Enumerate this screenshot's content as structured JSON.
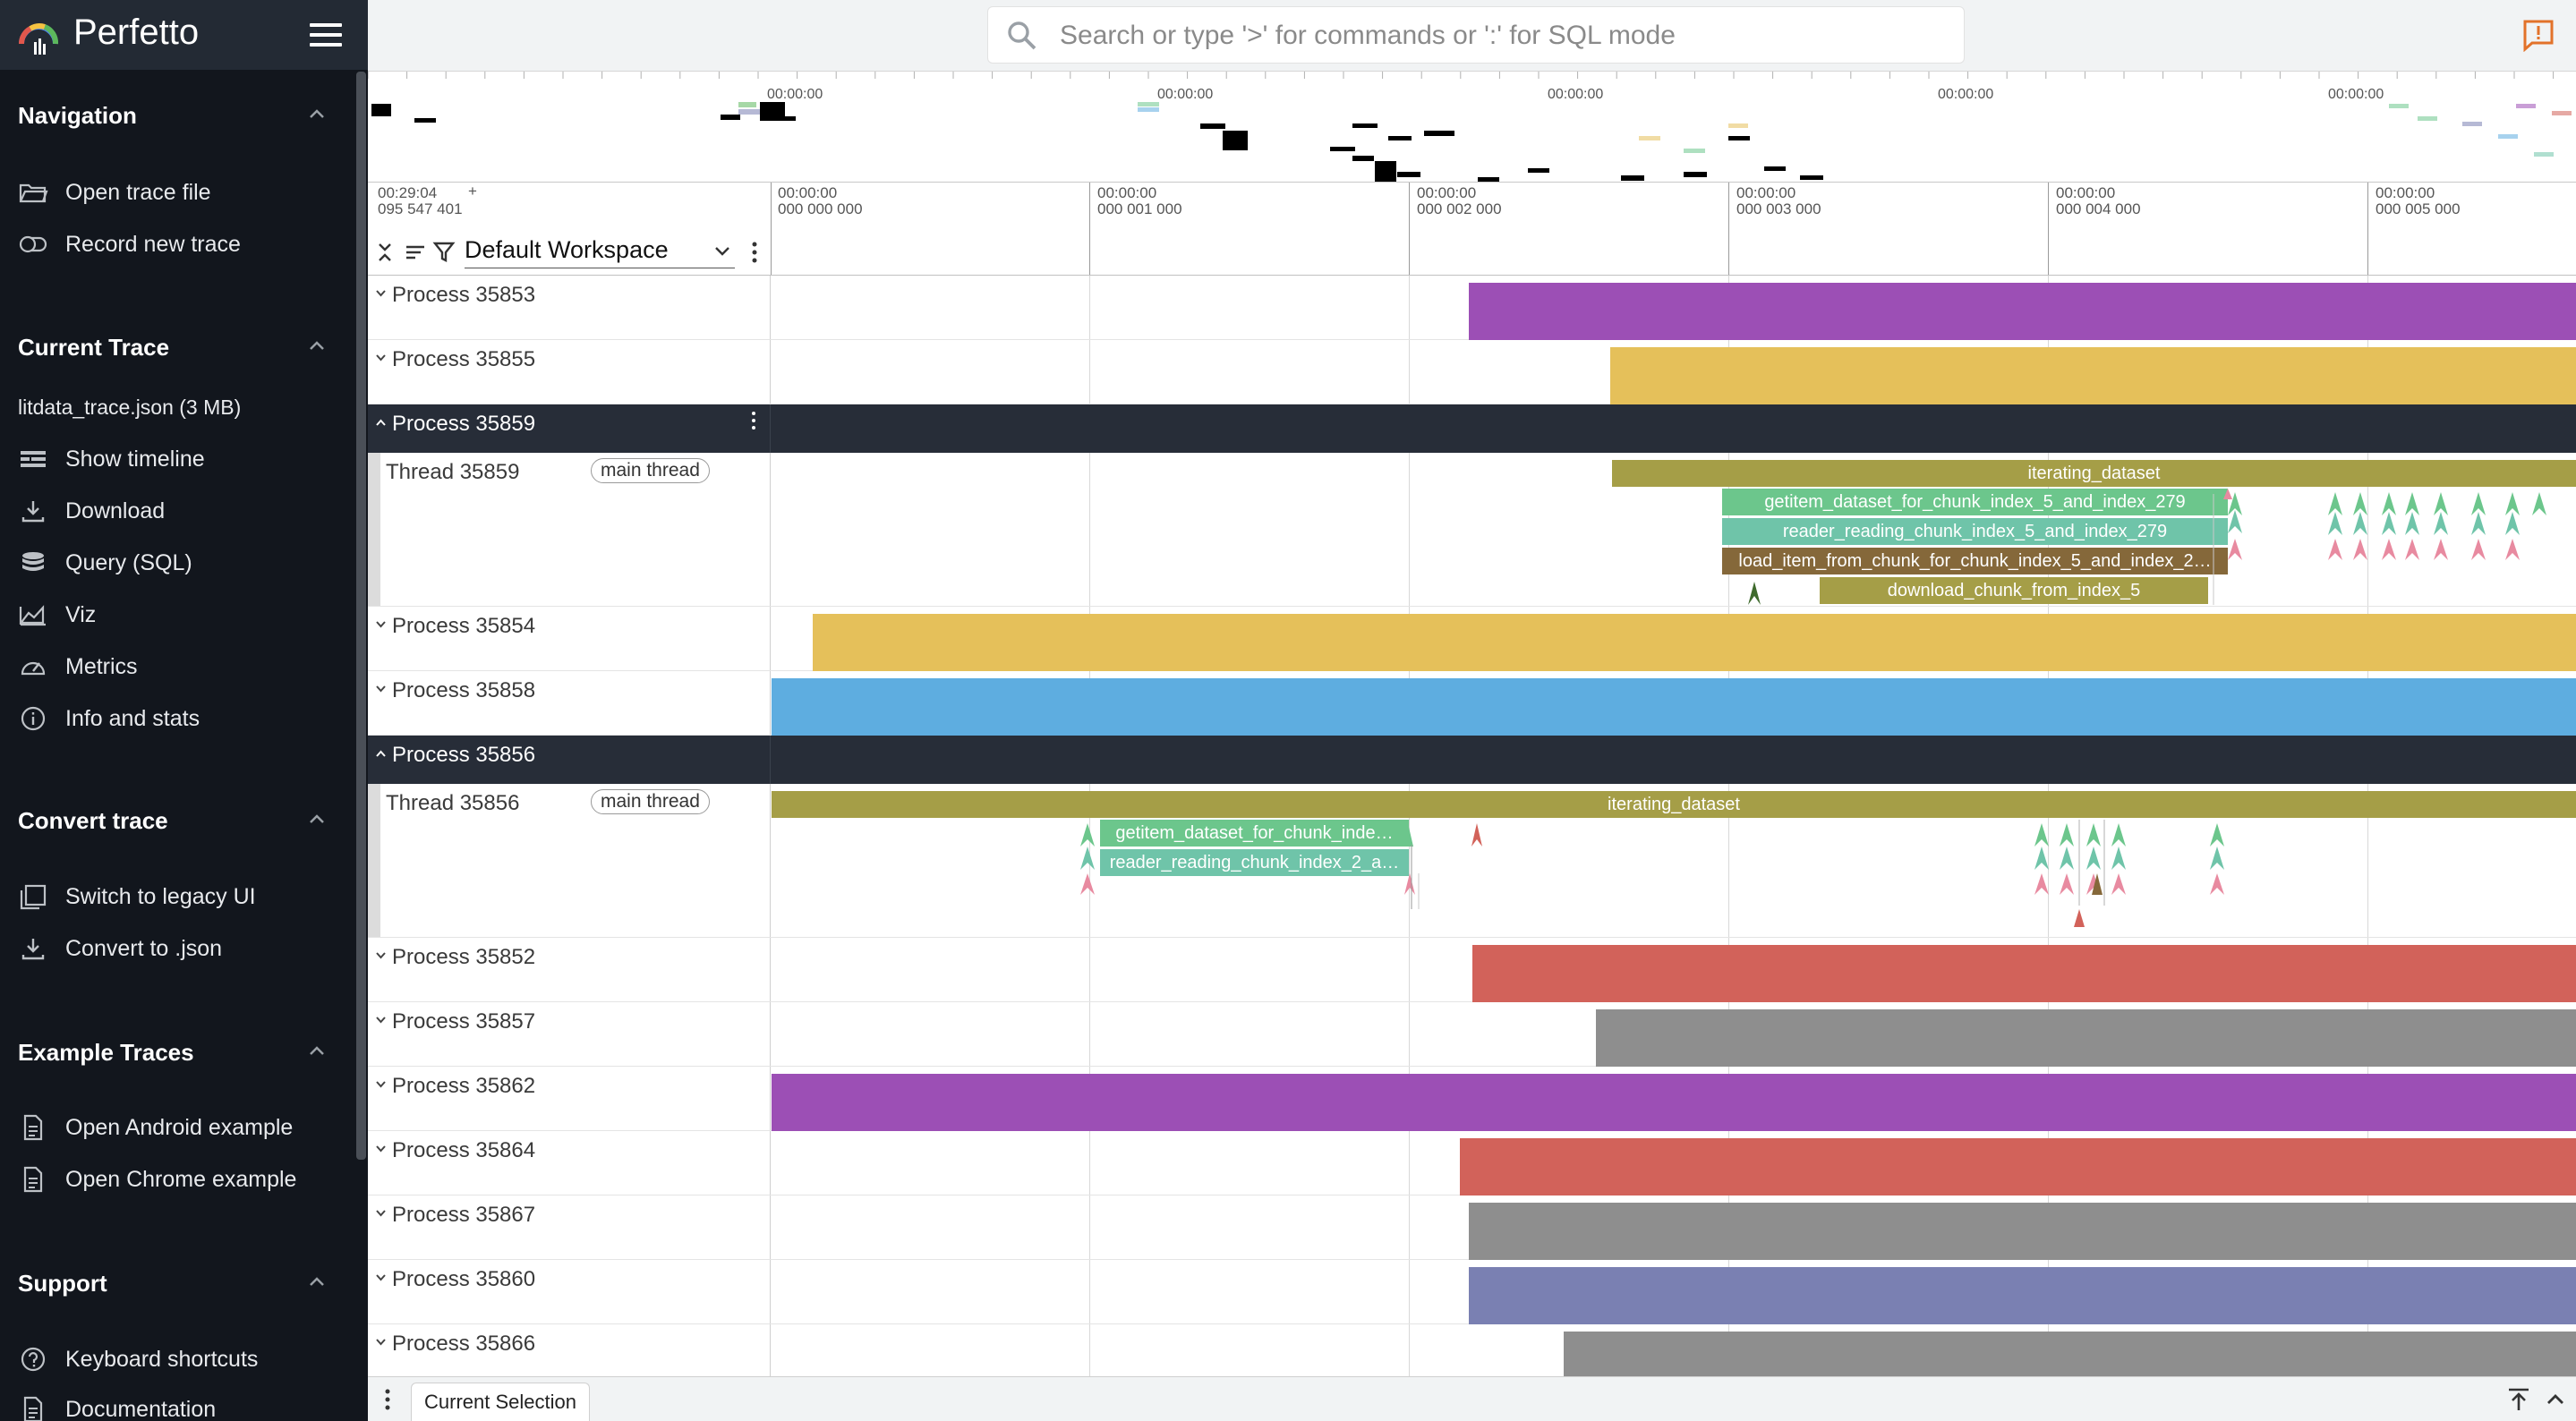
{
  "app": {
    "name": "Perfetto"
  },
  "sidebar": {
    "sections": [
      {
        "title": "Navigation",
        "items": [
          {
            "label": "Open trace file",
            "icon": "folder-open-icon"
          },
          {
            "label": "Record new trace",
            "icon": "record-icon"
          }
        ]
      },
      {
        "title": "Current Trace",
        "file": "litdata_trace.json (3 MB)",
        "items": [
          {
            "label": "Show timeline",
            "icon": "timeline-icon"
          },
          {
            "label": "Download",
            "icon": "download-icon"
          },
          {
            "label": "Query (SQL)",
            "icon": "database-icon"
          },
          {
            "label": "Viz",
            "icon": "chart-icon"
          },
          {
            "label": "Metrics",
            "icon": "speedometer-icon"
          },
          {
            "label": "Info and stats",
            "icon": "info-icon"
          }
        ]
      },
      {
        "title": "Convert trace",
        "items": [
          {
            "label": "Switch to legacy UI",
            "icon": "filter-none-icon"
          },
          {
            "label": "Convert to .json",
            "icon": "download-icon"
          }
        ]
      },
      {
        "title": "Example Traces",
        "items": [
          {
            "label": "Open Android example",
            "icon": "document-icon"
          },
          {
            "label": "Open Chrome example",
            "icon": "document-icon"
          }
        ]
      },
      {
        "title": "Support",
        "items": [
          {
            "label": "Keyboard shortcuts",
            "icon": "help-icon"
          },
          {
            "label": "Documentation",
            "icon": "document-icon"
          }
        ]
      }
    ]
  },
  "search": {
    "placeholder": "Search or type '>' for commands or ':' for SQL mode"
  },
  "overview": {
    "tick_labels": [
      "00:00:00",
      "00:00:00",
      "00:00:00",
      "00:00:00",
      "00:00:00"
    ]
  },
  "timeline": {
    "start_time": "00:29:04",
    "start_sub": "095 547 401",
    "plus": "+",
    "ticks": [
      {
        "t1": "00:00:00",
        "t2": "000 000 000"
      },
      {
        "t1": "00:00:00",
        "t2": "000 001 000"
      },
      {
        "t1": "00:00:00",
        "t2": "000 002 000"
      },
      {
        "t1": "00:00:00",
        "t2": "000 003 000"
      },
      {
        "t1": "00:00:00",
        "t2": "000 004 000"
      },
      {
        "t1": "00:00:00",
        "t2": "000 005 000"
      }
    ]
  },
  "workspace": {
    "name": "Default Workspace"
  },
  "tracks": [
    {
      "type": "process",
      "name": "Process 35853",
      "color": "#9c4fb5"
    },
    {
      "type": "process",
      "name": "Process 35855",
      "color": "#e5c05a"
    },
    {
      "type": "process-header",
      "name": "Process 35859"
    },
    {
      "type": "thread",
      "name": "Thread 35859",
      "tag": "main thread",
      "slices": [
        {
          "label": "iterating_dataset",
          "color": "#a59e47"
        },
        {
          "label": "getitem_dataset_for_chunk_index_5_and_index_279",
          "color": "#6cc68c"
        },
        {
          "label": "reader_reading_chunk_index_5_and_index_279",
          "color": "#6fc4a9"
        },
        {
          "label": "load_item_from_chunk_for_chunk_index_5_and_index_2…",
          "color": "#85683a"
        },
        {
          "label": "download_chunk_from_index_5",
          "color": "#a59e47"
        }
      ]
    },
    {
      "type": "process",
      "name": "Process 35854",
      "color": "#e5c05a"
    },
    {
      "type": "process",
      "name": "Process 35858",
      "color": "#5eade0"
    },
    {
      "type": "process-header",
      "name": "Process 35856"
    },
    {
      "type": "thread",
      "name": "Thread 35856",
      "tag": "main thread",
      "slices": [
        {
          "label": "iterating_dataset",
          "color": "#a59e47"
        },
        {
          "label": "getitem_dataset_for_chunk_inde…",
          "color": "#6cc68c"
        },
        {
          "label": "reader_reading_chunk_index_2_a…",
          "color": "#6fc4a9"
        }
      ]
    },
    {
      "type": "process",
      "name": "Process 35852",
      "color": "#d2625a"
    },
    {
      "type": "process",
      "name": "Process 35857",
      "color": "#8e8e8e"
    },
    {
      "type": "process",
      "name": "Process 35862",
      "color": "#9c4fb5"
    },
    {
      "type": "process",
      "name": "Process 35864",
      "color": "#d2625a"
    },
    {
      "type": "process",
      "name": "Process 35867",
      "color": "#8e8e8e"
    },
    {
      "type": "process",
      "name": "Process 35860",
      "color": "#7a80b2"
    },
    {
      "type": "process",
      "name": "Process 35866",
      "color": "#8e8e8e"
    }
  ],
  "bottom_panel": {
    "tab": "Current Selection"
  }
}
